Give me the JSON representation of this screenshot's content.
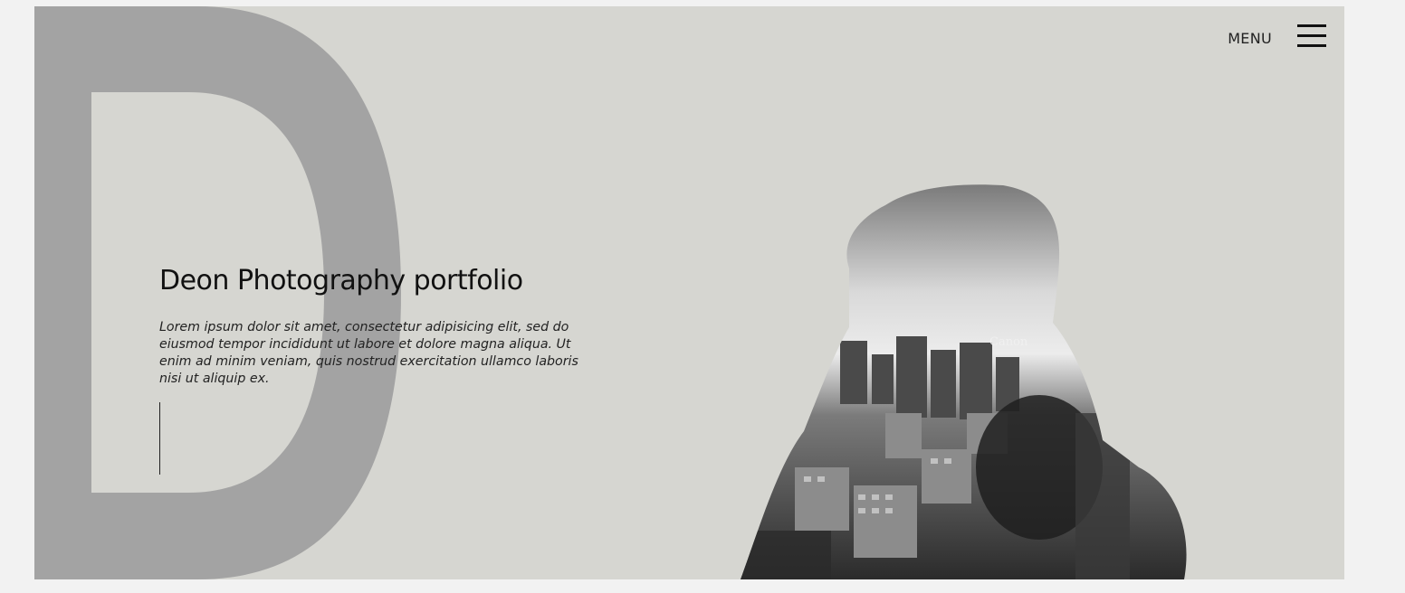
{
  "hero": {
    "monogram": "D",
    "title": "Deon Photography portfolio",
    "description": "Lorem ipsum dolor sit amet, consectetur adipisicing elit, sed do eiusmod tempor incididunt ut labore et dolore magna aliqua. Ut enim ad minim veniam, quis nostrud exercitation ullamco laboris nisi ut aliquip ex.",
    "camera_brand": "Canon"
  },
  "header": {
    "menu_label": "MENU",
    "menu_icon": "hamburger-icon"
  },
  "colors": {
    "page_background": "#f2f2f2",
    "hero_background": "#d6d6d1",
    "monogram": "#a3a3a3",
    "text": "#111111"
  }
}
